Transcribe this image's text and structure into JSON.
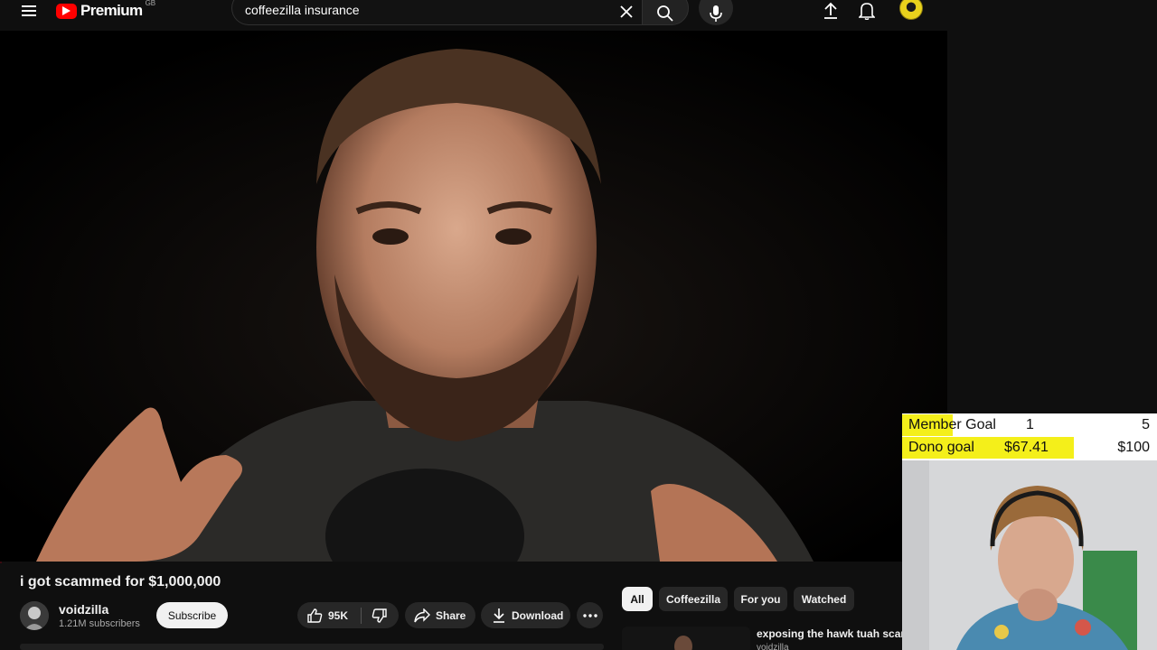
{
  "header": {
    "logo_text": "Premium",
    "country_code": "GB",
    "search_value": "coffeezilla insurance"
  },
  "video": {
    "title": "i got scammed for $1,000,000",
    "channel_name": "voidzilla",
    "channel_subscribers": "1.21M subscribers",
    "subscribe_label": "Subscribe",
    "like_count": "95K",
    "share_label": "Share",
    "download_label": "Download"
  },
  "filters": {
    "chips": [
      "All",
      "Coffeezilla",
      "For you",
      "Watched"
    ],
    "active": "All"
  },
  "recommendation": {
    "title": "exposing the hawk tuah scam",
    "channel": "voidzilla"
  },
  "overlay": {
    "member_goal": {
      "label": "Member Goal",
      "current": "1",
      "target": "5",
      "progress": 0.2
    },
    "dono_goal": {
      "label": "Dono goal",
      "current": "$67.41",
      "target": "$100",
      "progress": 0.674
    }
  },
  "colors": {
    "background": "#0f0f0f",
    "youtube_red": "#ff0000",
    "goal_yellow": "#f4ef1a"
  },
  "icons": {
    "menu": "menu-icon",
    "search": "search-icon",
    "clear": "close-icon",
    "mic": "mic-icon",
    "upload": "upload-icon",
    "notifications": "bell-icon",
    "like": "thumbs-up-icon",
    "dislike": "thumbs-down-icon",
    "share": "share-icon",
    "download": "download-icon",
    "more": "more-horizontal-icon"
  }
}
